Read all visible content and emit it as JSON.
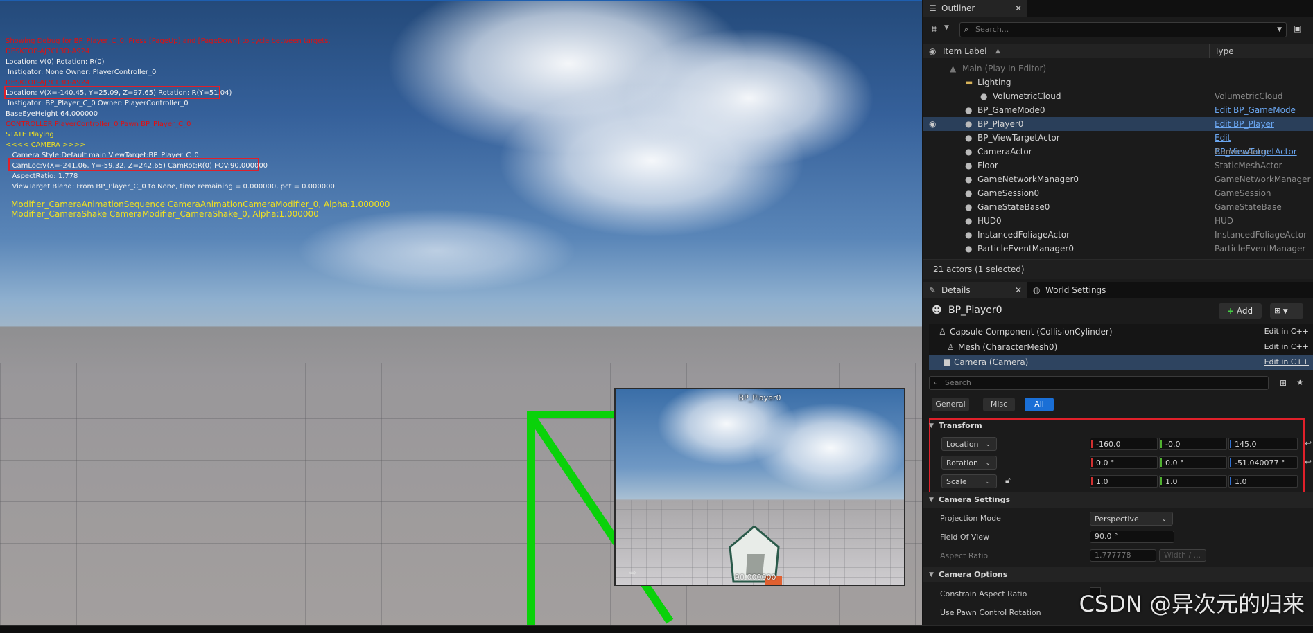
{
  "viewport": {
    "debug_lines": [
      {
        "text": "Showing Debug for BP_Player_C_0, Press [PageUp] and [PageDown] to cycle between targets.",
        "color": "red"
      },
      {
        "text": "DESKTOP-AJ7CL3D-A924",
        "color": "red"
      },
      {
        "text": "Location: V(0) Rotation: R(0)",
        "color": "white"
      },
      {
        "text": " Instigator: None Owner: PlayerController_0",
        "color": "white"
      },
      {
        "text": "DESKTOP-AJ7CL3D-A924",
        "color": "red"
      },
      {
        "text": "Location: V(X=-140.45, Y=25.09, Z=97.65) Rotation: R(Y=51.04)",
        "color": "white"
      },
      {
        "text": " Instigator: BP_Player_C_0 Owner: PlayerController_0",
        "color": "white"
      },
      {
        "text": "BaseEyeHeight 64.000000",
        "color": "white"
      },
      {
        "text": "CONTROLLER PlayerController_0 Pawn BP_Player_C_0",
        "color": "red"
      },
      {
        "text": "STATE Playing",
        "color": "yellow"
      },
      {
        "text": "<<<< CAMERA >>>>",
        "color": "yellow"
      },
      {
        "text": "   Camera Style:Default main ViewTarget:BP_Player_C_0",
        "color": "white"
      },
      {
        "text": "   CamLoc:V(X=-241.06, Y=-59.32, Z=242.65) CamRot:R(0) FOV:90.000000",
        "color": "white"
      },
      {
        "text": "   AspectRatio: 1.778",
        "color": "white"
      },
      {
        "text": "   ViewTarget Blend: From BP_Player_C_0 to None, time remaining = 0.000000, pct = 0.000000",
        "color": "white"
      }
    ],
    "modifier_lines": [
      "Modifier_CameraAnimationSequence CameraAnimationCameraModifier_0, Alpha:1.000000",
      "Modifier_CameraShake CameraModifier_CameraShake_0, Alpha:1.000000"
    ],
    "pip": {
      "title": "BP_Player0",
      "fov_text": "90.000000"
    }
  },
  "outliner": {
    "tab_label": "Outliner",
    "search_placeholder": "Search...",
    "col_label": "Item Label",
    "col_type": "Type",
    "rows": [
      {
        "label": "Main (Play In Editor)",
        "type": "",
        "indent": 1,
        "dim": true
      },
      {
        "label": "Lighting",
        "type": "",
        "indent": 2,
        "folder": true
      },
      {
        "label": "VolumetricCloud",
        "type": "VolumetricCloud",
        "indent": 3
      },
      {
        "label": "BP_GameMode0",
        "type": "Edit BP_GameMode",
        "indent": 2,
        "link": true
      },
      {
        "label": "BP_Player0",
        "type": "Edit BP_Player",
        "indent": 2,
        "link": true,
        "selected": true
      },
      {
        "label": "BP_ViewTargetActor",
        "type": "Edit BP_ViewTargetActor",
        "indent": 2,
        "link": true
      },
      {
        "label": "CameraActor",
        "type": "CameraActor",
        "indent": 2
      },
      {
        "label": "Floor",
        "type": "StaticMeshActor",
        "indent": 2
      },
      {
        "label": "GameNetworkManager0",
        "type": "GameNetworkManager",
        "indent": 2
      },
      {
        "label": "GameSession0",
        "type": "GameSession",
        "indent": 2
      },
      {
        "label": "GameStateBase0",
        "type": "GameStateBase",
        "indent": 2
      },
      {
        "label": "HUD0",
        "type": "HUD",
        "indent": 2
      },
      {
        "label": "InstancedFoliageActor",
        "type": "InstancedFoliageActor",
        "indent": 2
      },
      {
        "label": "ParticleEventManager0",
        "type": "ParticleEventManager",
        "indent": 2
      }
    ],
    "status": "21 actors (1 selected)"
  },
  "details": {
    "tab_label": "Details",
    "tab2_label": "World Settings",
    "actor_name": "BP_Player0",
    "add_label": "Add",
    "components": [
      {
        "label": "Capsule Component (CollisionCylinder)",
        "edit": "Edit in C++"
      },
      {
        "label": "Mesh (CharacterMesh0)",
        "edit": "Edit in C++"
      },
      {
        "label": "Camera (Camera)",
        "edit": "Edit in C++",
        "selected": true
      }
    ],
    "search_placeholder": "Search",
    "filters": [
      "General",
      "Misc",
      "All"
    ],
    "transform": {
      "title": "Transform",
      "location": {
        "label": "Location",
        "x": "-160.0",
        "y": "-0.0",
        "z": "145.0"
      },
      "rotation": {
        "label": "Rotation",
        "x": "0.0 °",
        "y": "0.0 °",
        "z": "-51.040077 °"
      },
      "scale": {
        "label": "Scale",
        "x": "1.0",
        "y": "1.0",
        "z": "1.0"
      }
    },
    "camera_settings": {
      "title": "Camera Settings",
      "projection_label": "Projection Mode",
      "projection_value": "Perspective",
      "fov_label": "Field Of View",
      "fov_value": "90.0 °",
      "aspect_label": "Aspect Ratio",
      "aspect_value": "1.777778",
      "aspect_preset": "Width / ..."
    },
    "camera_options": {
      "title": "Camera Options",
      "constrain_label": "Constrain Aspect Ratio",
      "pawn_label": "Use Pawn Control Rotation"
    }
  },
  "watermark": "CSDN @异次元的归来",
  "colors": {
    "accent": "#1a6fd6",
    "highlight": "#e0202a",
    "green_line": "#0ad20a"
  }
}
